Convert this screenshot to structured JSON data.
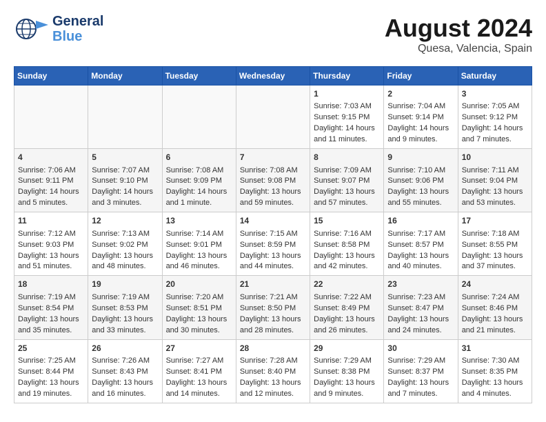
{
  "header": {
    "logo_general": "General",
    "logo_blue": "Blue",
    "main_title": "August 2024",
    "subtitle": "Quesa, Valencia, Spain"
  },
  "days_of_week": [
    "Sunday",
    "Monday",
    "Tuesday",
    "Wednesday",
    "Thursday",
    "Friday",
    "Saturday"
  ],
  "weeks": [
    [
      {
        "day": "",
        "content": ""
      },
      {
        "day": "",
        "content": ""
      },
      {
        "day": "",
        "content": ""
      },
      {
        "day": "",
        "content": ""
      },
      {
        "day": "1",
        "content": "Sunrise: 7:03 AM\nSunset: 9:15 PM\nDaylight: 14 hours\nand 11 minutes."
      },
      {
        "day": "2",
        "content": "Sunrise: 7:04 AM\nSunset: 9:14 PM\nDaylight: 14 hours\nand 9 minutes."
      },
      {
        "day": "3",
        "content": "Sunrise: 7:05 AM\nSunset: 9:12 PM\nDaylight: 14 hours\nand 7 minutes."
      }
    ],
    [
      {
        "day": "4",
        "content": "Sunrise: 7:06 AM\nSunset: 9:11 PM\nDaylight: 14 hours\nand 5 minutes."
      },
      {
        "day": "5",
        "content": "Sunrise: 7:07 AM\nSunset: 9:10 PM\nDaylight: 14 hours\nand 3 minutes."
      },
      {
        "day": "6",
        "content": "Sunrise: 7:08 AM\nSunset: 9:09 PM\nDaylight: 14 hours\nand 1 minute."
      },
      {
        "day": "7",
        "content": "Sunrise: 7:08 AM\nSunset: 9:08 PM\nDaylight: 13 hours\nand 59 minutes."
      },
      {
        "day": "8",
        "content": "Sunrise: 7:09 AM\nSunset: 9:07 PM\nDaylight: 13 hours\nand 57 minutes."
      },
      {
        "day": "9",
        "content": "Sunrise: 7:10 AM\nSunset: 9:06 PM\nDaylight: 13 hours\nand 55 minutes."
      },
      {
        "day": "10",
        "content": "Sunrise: 7:11 AM\nSunset: 9:04 PM\nDaylight: 13 hours\nand 53 minutes."
      }
    ],
    [
      {
        "day": "11",
        "content": "Sunrise: 7:12 AM\nSunset: 9:03 PM\nDaylight: 13 hours\nand 51 minutes."
      },
      {
        "day": "12",
        "content": "Sunrise: 7:13 AM\nSunset: 9:02 PM\nDaylight: 13 hours\nand 48 minutes."
      },
      {
        "day": "13",
        "content": "Sunrise: 7:14 AM\nSunset: 9:01 PM\nDaylight: 13 hours\nand 46 minutes."
      },
      {
        "day": "14",
        "content": "Sunrise: 7:15 AM\nSunset: 8:59 PM\nDaylight: 13 hours\nand 44 minutes."
      },
      {
        "day": "15",
        "content": "Sunrise: 7:16 AM\nSunset: 8:58 PM\nDaylight: 13 hours\nand 42 minutes."
      },
      {
        "day": "16",
        "content": "Sunrise: 7:17 AM\nSunset: 8:57 PM\nDaylight: 13 hours\nand 40 minutes."
      },
      {
        "day": "17",
        "content": "Sunrise: 7:18 AM\nSunset: 8:55 PM\nDaylight: 13 hours\nand 37 minutes."
      }
    ],
    [
      {
        "day": "18",
        "content": "Sunrise: 7:19 AM\nSunset: 8:54 PM\nDaylight: 13 hours\nand 35 minutes."
      },
      {
        "day": "19",
        "content": "Sunrise: 7:19 AM\nSunset: 8:53 PM\nDaylight: 13 hours\nand 33 minutes."
      },
      {
        "day": "20",
        "content": "Sunrise: 7:20 AM\nSunset: 8:51 PM\nDaylight: 13 hours\nand 30 minutes."
      },
      {
        "day": "21",
        "content": "Sunrise: 7:21 AM\nSunset: 8:50 PM\nDaylight: 13 hours\nand 28 minutes."
      },
      {
        "day": "22",
        "content": "Sunrise: 7:22 AM\nSunset: 8:49 PM\nDaylight: 13 hours\nand 26 minutes."
      },
      {
        "day": "23",
        "content": "Sunrise: 7:23 AM\nSunset: 8:47 PM\nDaylight: 13 hours\nand 24 minutes."
      },
      {
        "day": "24",
        "content": "Sunrise: 7:24 AM\nSunset: 8:46 PM\nDaylight: 13 hours\nand 21 minutes."
      }
    ],
    [
      {
        "day": "25",
        "content": "Sunrise: 7:25 AM\nSunset: 8:44 PM\nDaylight: 13 hours\nand 19 minutes."
      },
      {
        "day": "26",
        "content": "Sunrise: 7:26 AM\nSunset: 8:43 PM\nDaylight: 13 hours\nand 16 minutes."
      },
      {
        "day": "27",
        "content": "Sunrise: 7:27 AM\nSunset: 8:41 PM\nDaylight: 13 hours\nand 14 minutes."
      },
      {
        "day": "28",
        "content": "Sunrise: 7:28 AM\nSunset: 8:40 PM\nDaylight: 13 hours\nand 12 minutes."
      },
      {
        "day": "29",
        "content": "Sunrise: 7:29 AM\nSunset: 8:38 PM\nDaylight: 13 hours\nand 9 minutes."
      },
      {
        "day": "30",
        "content": "Sunrise: 7:29 AM\nSunset: 8:37 PM\nDaylight: 13 hours\nand 7 minutes."
      },
      {
        "day": "31",
        "content": "Sunrise: 7:30 AM\nSunset: 8:35 PM\nDaylight: 13 hours\nand 4 minutes."
      }
    ]
  ]
}
